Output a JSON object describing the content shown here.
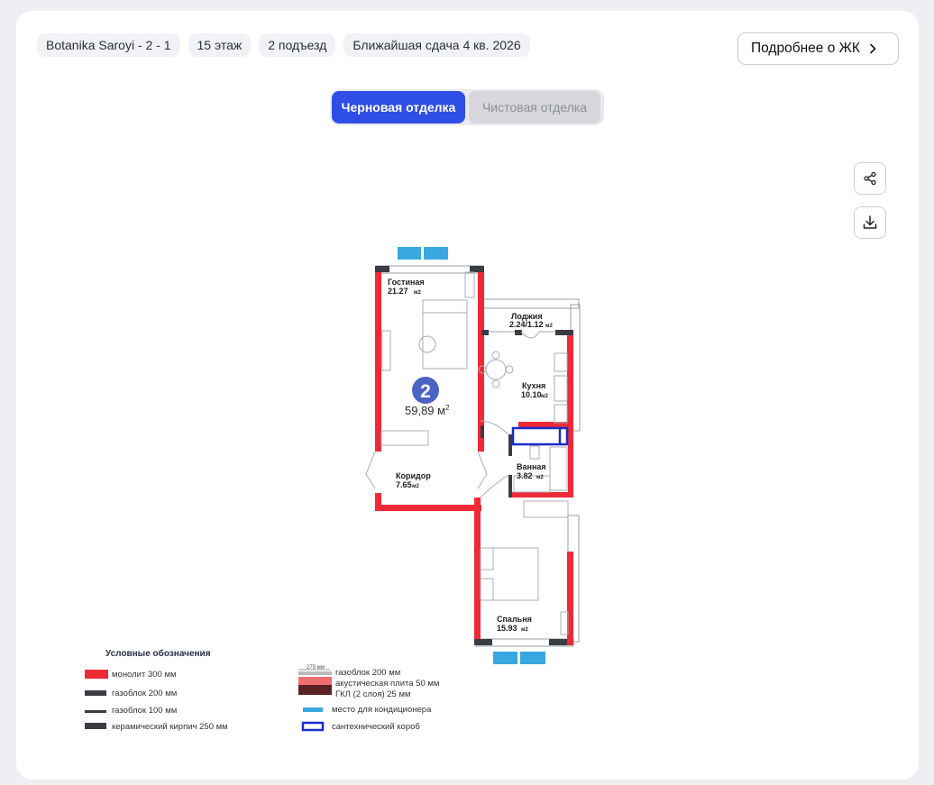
{
  "header": {
    "chips": [
      "Botanika Saroyi - 2 - 1",
      "15 этаж",
      "2 подъезд",
      "Ближайшая сдача 4 кв. 2026"
    ],
    "more_label": "Подробнее о ЖК"
  },
  "finish_toggle": {
    "options": [
      "Черновая отделка",
      "Чистовая отделка"
    ],
    "selected": "Черновая отделка"
  },
  "actions": {
    "share_icon": "share-icon",
    "download_icon": "download-icon"
  },
  "plan": {
    "rooms_count": "2",
    "total_area": "59,89 м",
    "total_area_sup": "2",
    "rooms": [
      {
        "name": "Гостиная",
        "area": "21.27",
        "unit": "м2"
      },
      {
        "name": "Лоджия",
        "area": "2.24/1.12",
        "unit": "м2"
      },
      {
        "name": "Кухня",
        "area": "10.10",
        "unit": "м2"
      },
      {
        "name": "Ванная",
        "area": "3.82",
        "unit": "м2"
      },
      {
        "name": "Коридор",
        "area": "7.65",
        "unit": "м2"
      },
      {
        "name": "Спальня",
        "area": "15.93",
        "unit": "м2"
      }
    ]
  },
  "legend": {
    "title": "Условные обозначения",
    "items_left": [
      "монолит 300 мм",
      "газоблок 200 мм",
      "газоблок 100 мм",
      "керамический кирпич 250 мм"
    ],
    "dim_label": "275 мм",
    "items_right": [
      "газоблок 200 мм",
      "акустическая плита 50 мм",
      "ГКЛ (2 слоя) 25 мм",
      "место для кондиционера",
      "сантехнический короб"
    ]
  },
  "colors": {
    "accent": "#2e4ee6",
    "monolith": "#ee2a36",
    "ac_place": "#3aa8e0",
    "plumbing_box": "#1a2cc9",
    "badge": "#4a63c4"
  }
}
